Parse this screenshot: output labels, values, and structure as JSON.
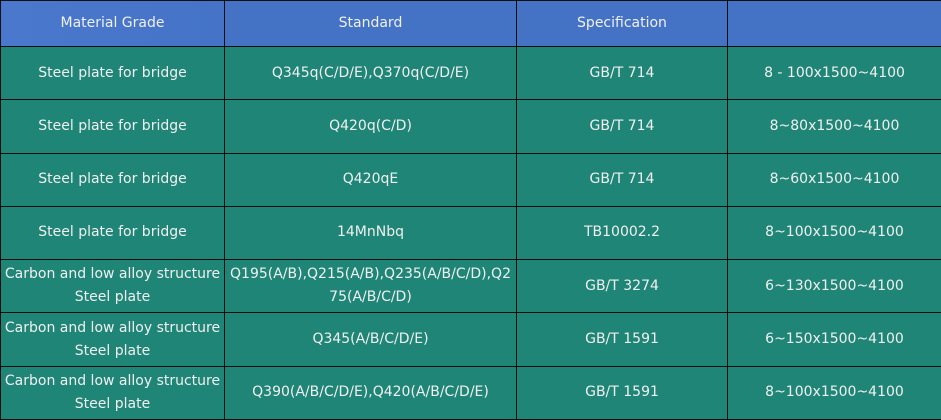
{
  "table": {
    "headers": [
      "Material Grade",
      "Standard",
      "Specification",
      ""
    ],
    "rows": [
      {
        "grade": "Steel plate for bridge",
        "standard": "Q345q(C/D/E),Q370q(C/D/E)",
        "spec": "GB/T 714",
        "size": "8 - 100x1500~4100"
      },
      {
        "grade": "Steel plate for bridge",
        "standard": "Q420q(C/D)",
        "spec": "GB/T 714",
        "size": "8~80x1500~4100"
      },
      {
        "grade": "Steel plate for bridge",
        "standard": "Q420qE",
        "spec": "GB/T 714",
        "size": "8~60x1500~4100"
      },
      {
        "grade": "Steel plate for bridge",
        "standard": "14MnNbq",
        "spec": "TB10002.2",
        "size": "8~100x1500~4100"
      },
      {
        "grade": "Carbon and low alloy structure Steel plate",
        "standard": "Q195(A/B),Q215(A/B),Q235(A/B/C/D),Q275(A/B/C/D)",
        "spec": "GB/T 3274",
        "size": "6~130x1500~4100"
      },
      {
        "grade": "Carbon and low alloy structure Steel plate",
        "standard": "Q345(A/B/C/D/E)",
        "spec": "GB/T 1591",
        "size": "6~150x1500~4100"
      },
      {
        "grade": "Carbon and low alloy structure Steel plate",
        "standard": "Q390(A/B/C/D/E),Q420(A/B/C/D/E)",
        "spec": "GB/T 1591",
        "size": "8~100x1500~4100"
      }
    ]
  },
  "colors": {
    "header_bg": "#4472c4",
    "body_bg": "#1f8577",
    "border": "#0d0d0d",
    "text": "#f0f0f0"
  }
}
